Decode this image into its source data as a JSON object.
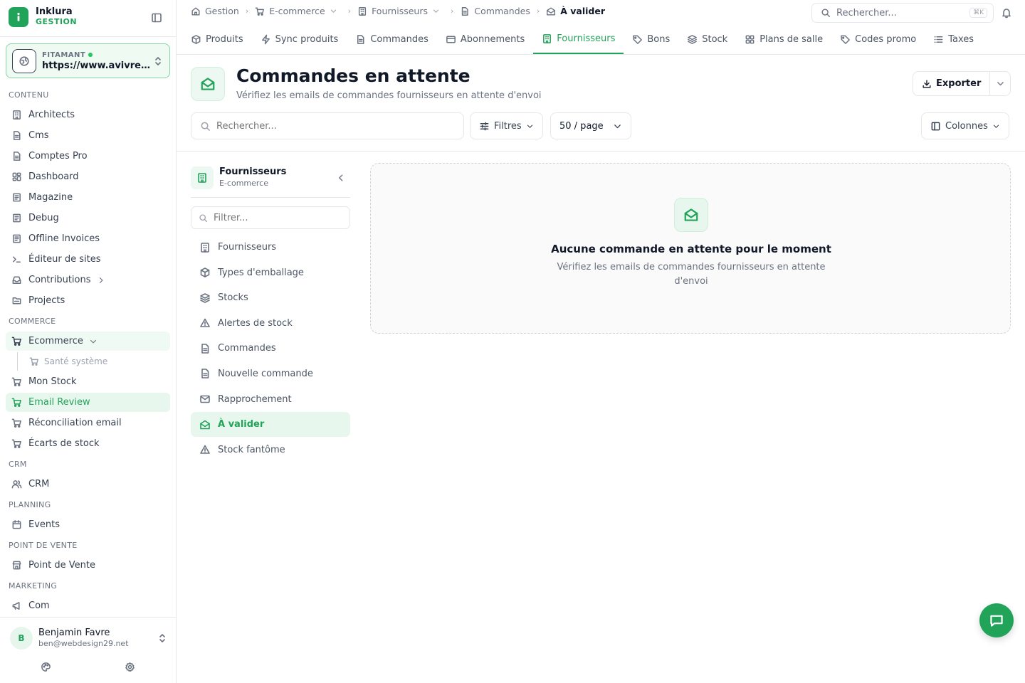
{
  "brand": {
    "name": "Inklura",
    "sub": "GESTION"
  },
  "site": {
    "tag": "FITAMANT",
    "url": "https://www.avivre.fr"
  },
  "nav": {
    "sections": {
      "contenu": "CONTENU",
      "commerce": "COMMERCE",
      "crm": "CRM",
      "planning": "PLANNING",
      "pos": "POINT DE VENTE",
      "marketing": "MARKETING"
    },
    "items": {
      "architects": "Architects",
      "cms": "Cms",
      "comptes_pro": "Comptes Pro",
      "dashboard": "Dashboard",
      "magazine": "Magazine",
      "debug": "Debug",
      "offline_invoices": "Offline Invoices",
      "editeur": "Éditeur de sites",
      "contributions": "Contributions",
      "projects": "Projects",
      "ecommerce": "Ecommerce",
      "sante": "Santé système",
      "mon_stock": "Mon Stock",
      "email_review": "Email Review",
      "reconciliation": "Réconciliation email",
      "ecarts": "Écarts de stock",
      "crm": "CRM",
      "events": "Events",
      "pos": "Point de Vente",
      "com": "Com"
    }
  },
  "user": {
    "initial": "B",
    "name": "Benjamin Favre",
    "email": "ben@webdesign29.net"
  },
  "breadcrumb": {
    "gestion": "Gestion",
    "ecommerce": "E-commerce",
    "fournisseurs": "Fournisseurs",
    "commandes": "Commandes",
    "current": "À valider"
  },
  "global_search": {
    "placeholder": "Rechercher...",
    "shortcut": "⌘K"
  },
  "tabs": {
    "produits": "Produits",
    "sync": "Sync produits",
    "commandes": "Commandes",
    "abonnements": "Abonnements",
    "fournisseurs": "Fournisseurs",
    "bons": "Bons",
    "stock": "Stock",
    "plans": "Plans de salle",
    "codes": "Codes promo",
    "taxes": "Taxes"
  },
  "page": {
    "title": "Commandes en attente",
    "subtitle": "Vérifiez les emails de commandes fournisseurs en attente d'envoi",
    "export_label": "Exporter"
  },
  "toolbar": {
    "search_placeholder": "Rechercher...",
    "filters_label": "Filtres",
    "per_page": "50 / page",
    "columns_label": "Colonnes"
  },
  "panel": {
    "title": "Fournisseurs",
    "subtitle": "E-commerce",
    "filter_placeholder": "Filtrer...",
    "items": {
      "fournisseurs": "Fournisseurs",
      "emballage": "Types d'emballage",
      "stocks": "Stocks",
      "alertes": "Alertes de stock",
      "commandes": "Commandes",
      "nouvelle": "Nouvelle commande",
      "rapprochement": "Rapprochement",
      "a_valider": "À valider",
      "fantome": "Stock fantôme"
    }
  },
  "empty": {
    "title": "Aucune commande en attente pour le moment",
    "subtitle": "Vérifiez les emails de commandes fournisseurs en attente d'envoi"
  },
  "colors": {
    "accent": "#22a35a",
    "accent_bg": "#e8f7ee"
  }
}
